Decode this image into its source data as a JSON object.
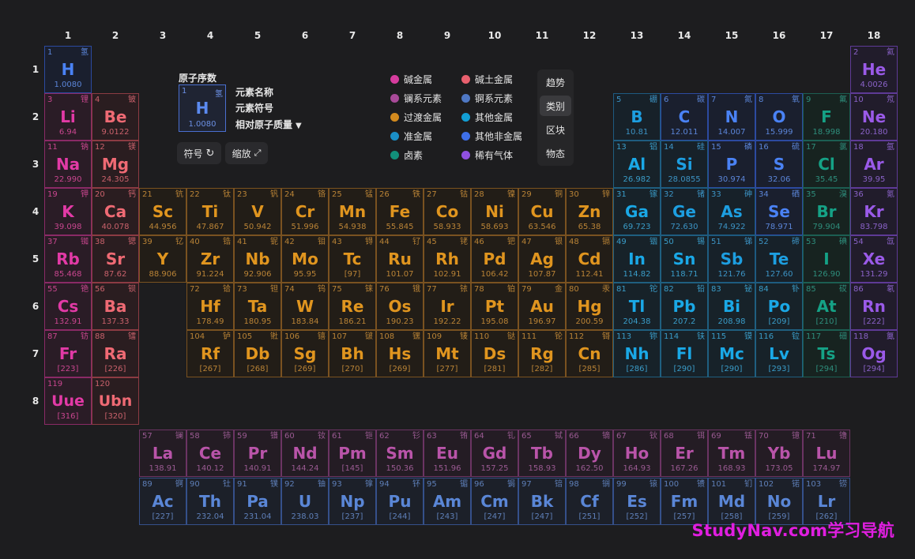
{
  "groups": [
    "1",
    "2",
    "3",
    "4",
    "5",
    "6",
    "7",
    "8",
    "9",
    "10",
    "11",
    "12",
    "13",
    "14",
    "15",
    "16",
    "17",
    "18"
  ],
  "periods": [
    "1",
    "2",
    "3",
    "4",
    "5",
    "6",
    "7",
    "8"
  ],
  "legend_key": {
    "atomic_number_label": "原子序数",
    "name_label": "元素名称",
    "symbol_label": "元素符号",
    "mass_label": "相对原子质量",
    "sample": {
      "num": "1",
      "cn": "氢",
      "sym": "H",
      "mass": "1.0080"
    }
  },
  "controls": {
    "symbol_label": "符号",
    "zoom_label": "缩放"
  },
  "categories": [
    {
      "key": "alkali",
      "label": "碱金属",
      "color": "#d63c9e"
    },
    {
      "key": "alkaline",
      "label": "碱土金属",
      "color": "#e8606e"
    },
    {
      "key": "lanthanide",
      "label": "镧系元素",
      "color": "#a84a98"
    },
    {
      "key": "actinide",
      "label": "锕系元素",
      "color": "#4f78c4"
    },
    {
      "key": "transition",
      "label": "过渡金属",
      "color": "#d38a1e"
    },
    {
      "key": "post",
      "label": "其他金属",
      "color": "#129ed4"
    },
    {
      "key": "metalloid",
      "label": "准金属",
      "color": "#1b8fc6"
    },
    {
      "key": "nonmetal",
      "label": "其他非金属",
      "color": "#3e6fe8"
    },
    {
      "key": "halogen",
      "label": "卤素",
      "color": "#12907a"
    },
    {
      "key": "noble",
      "label": "稀有气体",
      "color": "#9050e0"
    }
  ],
  "views": [
    {
      "label": "趋势",
      "active": false
    },
    {
      "label": "类别",
      "active": true
    },
    {
      "label": "区块",
      "active": false
    },
    {
      "label": "物态",
      "active": false
    }
  ],
  "watermark": "StudyNav.com学习导航",
  "elements": [
    {
      "n": "1",
      "s": "H",
      "c": "氢",
      "m": "1.0080",
      "g": 1,
      "p": 1,
      "k": "nonmetal"
    },
    {
      "n": "2",
      "s": "He",
      "c": "氦",
      "m": "4.0026",
      "g": 18,
      "p": 1,
      "k": "noble"
    },
    {
      "n": "3",
      "s": "Li",
      "c": "锂",
      "m": "6.94",
      "g": 1,
      "p": 2,
      "k": "alkali"
    },
    {
      "n": "4",
      "s": "Be",
      "c": "铍",
      "m": "9.0122",
      "g": 2,
      "p": 2,
      "k": "alkaline"
    },
    {
      "n": "5",
      "s": "B",
      "c": "硼",
      "m": "10.81",
      "g": 13,
      "p": 2,
      "k": "metalloid"
    },
    {
      "n": "6",
      "s": "C",
      "c": "碳",
      "m": "12.011",
      "g": 14,
      "p": 2,
      "k": "nonmetal"
    },
    {
      "n": "7",
      "s": "N",
      "c": "氮",
      "m": "14.007",
      "g": 15,
      "p": 2,
      "k": "nonmetal"
    },
    {
      "n": "8",
      "s": "O",
      "c": "氧",
      "m": "15.999",
      "g": 16,
      "p": 2,
      "k": "nonmetal"
    },
    {
      "n": "9",
      "s": "F",
      "c": "氟",
      "m": "18.998",
      "g": 17,
      "p": 2,
      "k": "halogen"
    },
    {
      "n": "10",
      "s": "Ne",
      "c": "氖",
      "m": "20.180",
      "g": 18,
      "p": 2,
      "k": "noble"
    },
    {
      "n": "11",
      "s": "Na",
      "c": "钠",
      "m": "22.990",
      "g": 1,
      "p": 3,
      "k": "alkali"
    },
    {
      "n": "12",
      "s": "Mg",
      "c": "镁",
      "m": "24.305",
      "g": 2,
      "p": 3,
      "k": "alkaline"
    },
    {
      "n": "13",
      "s": "Al",
      "c": "铝",
      "m": "26.982",
      "g": 13,
      "p": 3,
      "k": "post"
    },
    {
      "n": "14",
      "s": "Si",
      "c": "硅",
      "m": "28.0855",
      "g": 14,
      "p": 3,
      "k": "metalloid"
    },
    {
      "n": "15",
      "s": "P",
      "c": "磷",
      "m": "30.974",
      "g": 15,
      "p": 3,
      "k": "nonmetal"
    },
    {
      "n": "16",
      "s": "S",
      "c": "硫",
      "m": "32.06",
      "g": 16,
      "p": 3,
      "k": "nonmetal"
    },
    {
      "n": "17",
      "s": "Cl",
      "c": "氯",
      "m": "35.45",
      "g": 17,
      "p": 3,
      "k": "halogen"
    },
    {
      "n": "18",
      "s": "Ar",
      "c": "氩",
      "m": "39.95",
      "g": 18,
      "p": 3,
      "k": "noble"
    },
    {
      "n": "19",
      "s": "K",
      "c": "钾",
      "m": "39.098",
      "g": 1,
      "p": 4,
      "k": "alkali"
    },
    {
      "n": "20",
      "s": "Ca",
      "c": "钙",
      "m": "40.078",
      "g": 2,
      "p": 4,
      "k": "alkaline"
    },
    {
      "n": "21",
      "s": "Sc",
      "c": "钪",
      "m": "44.956",
      "g": 3,
      "p": 4,
      "k": "transition"
    },
    {
      "n": "22",
      "s": "Ti",
      "c": "钛",
      "m": "47.867",
      "g": 4,
      "p": 4,
      "k": "transition"
    },
    {
      "n": "23",
      "s": "V",
      "c": "钒",
      "m": "50.942",
      "g": 5,
      "p": 4,
      "k": "transition"
    },
    {
      "n": "24",
      "s": "Cr",
      "c": "铬",
      "m": "51.996",
      "g": 6,
      "p": 4,
      "k": "transition"
    },
    {
      "n": "25",
      "s": "Mn",
      "c": "锰",
      "m": "54.938",
      "g": 7,
      "p": 4,
      "k": "transition"
    },
    {
      "n": "26",
      "s": "Fe",
      "c": "铁",
      "m": "55.845",
      "g": 8,
      "p": 4,
      "k": "transition"
    },
    {
      "n": "27",
      "s": "Co",
      "c": "钴",
      "m": "58.933",
      "g": 9,
      "p": 4,
      "k": "transition"
    },
    {
      "n": "28",
      "s": "Ni",
      "c": "镍",
      "m": "58.693",
      "g": 10,
      "p": 4,
      "k": "transition"
    },
    {
      "n": "29",
      "s": "Cu",
      "c": "铜",
      "m": "63.546",
      "g": 11,
      "p": 4,
      "k": "transition"
    },
    {
      "n": "30",
      "s": "Zn",
      "c": "锌",
      "m": "65.38",
      "g": 12,
      "p": 4,
      "k": "transition"
    },
    {
      "n": "31",
      "s": "Ga",
      "c": "镓",
      "m": "69.723",
      "g": 13,
      "p": 4,
      "k": "post"
    },
    {
      "n": "32",
      "s": "Ge",
      "c": "锗",
      "m": "72.630",
      "g": 14,
      "p": 4,
      "k": "metalloid"
    },
    {
      "n": "33",
      "s": "As",
      "c": "砷",
      "m": "74.922",
      "g": 15,
      "p": 4,
      "k": "metalloid"
    },
    {
      "n": "34",
      "s": "Se",
      "c": "硒",
      "m": "78.971",
      "g": 16,
      "p": 4,
      "k": "nonmetal"
    },
    {
      "n": "35",
      "s": "Br",
      "c": "溴",
      "m": "79.904",
      "g": 17,
      "p": 4,
      "k": "halogen"
    },
    {
      "n": "36",
      "s": "Kr",
      "c": "氪",
      "m": "83.798",
      "g": 18,
      "p": 4,
      "k": "noble"
    },
    {
      "n": "37",
      "s": "Rb",
      "c": "铷",
      "m": "85.468",
      "g": 1,
      "p": 5,
      "k": "alkali"
    },
    {
      "n": "38",
      "s": "Sr",
      "c": "锶",
      "m": "87.62",
      "g": 2,
      "p": 5,
      "k": "alkaline"
    },
    {
      "n": "39",
      "s": "Y",
      "c": "钇",
      "m": "88.906",
      "g": 3,
      "p": 5,
      "k": "transition"
    },
    {
      "n": "40",
      "s": "Zr",
      "c": "锆",
      "m": "91.224",
      "g": 4,
      "p": 5,
      "k": "transition"
    },
    {
      "n": "41",
      "s": "Nb",
      "c": "铌",
      "m": "92.906",
      "g": 5,
      "p": 5,
      "k": "transition"
    },
    {
      "n": "42",
      "s": "Mo",
      "c": "钼",
      "m": "95.95",
      "g": 6,
      "p": 5,
      "k": "transition"
    },
    {
      "n": "43",
      "s": "Tc",
      "c": "锝",
      "m": "[97]",
      "g": 7,
      "p": 5,
      "k": "transition"
    },
    {
      "n": "44",
      "s": "Ru",
      "c": "钌",
      "m": "101.07",
      "g": 8,
      "p": 5,
      "k": "transition"
    },
    {
      "n": "45",
      "s": "Rh",
      "c": "铑",
      "m": "102.91",
      "g": 9,
      "p": 5,
      "k": "transition"
    },
    {
      "n": "46",
      "s": "Pd",
      "c": "钯",
      "m": "106.42",
      "g": 10,
      "p": 5,
      "k": "transition"
    },
    {
      "n": "47",
      "s": "Ag",
      "c": "银",
      "m": "107.87",
      "g": 11,
      "p": 5,
      "k": "transition"
    },
    {
      "n": "48",
      "s": "Cd",
      "c": "镉",
      "m": "112.41",
      "g": 12,
      "p": 5,
      "k": "transition"
    },
    {
      "n": "49",
      "s": "In",
      "c": "铟",
      "m": "114.82",
      "g": 13,
      "p": 5,
      "k": "post"
    },
    {
      "n": "50",
      "s": "Sn",
      "c": "锡",
      "m": "118.71",
      "g": 14,
      "p": 5,
      "k": "post"
    },
    {
      "n": "51",
      "s": "Sb",
      "c": "锑",
      "m": "121.76",
      "g": 15,
      "p": 5,
      "k": "metalloid"
    },
    {
      "n": "52",
      "s": "Te",
      "c": "碲",
      "m": "127.60",
      "g": 16,
      "p": 5,
      "k": "metalloid"
    },
    {
      "n": "53",
      "s": "I",
      "c": "碘",
      "m": "126.90",
      "g": 17,
      "p": 5,
      "k": "halogen"
    },
    {
      "n": "54",
      "s": "Xe",
      "c": "氙",
      "m": "131.29",
      "g": 18,
      "p": 5,
      "k": "noble"
    },
    {
      "n": "55",
      "s": "Cs",
      "c": "铯",
      "m": "132.91",
      "g": 1,
      "p": 6,
      "k": "alkali"
    },
    {
      "n": "56",
      "s": "Ba",
      "c": "钡",
      "m": "137.33",
      "g": 2,
      "p": 6,
      "k": "alkaline"
    },
    {
      "n": "72",
      "s": "Hf",
      "c": "铪",
      "m": "178.49",
      "g": 4,
      "p": 6,
      "k": "transition"
    },
    {
      "n": "73",
      "s": "Ta",
      "c": "钽",
      "m": "180.95",
      "g": 5,
      "p": 6,
      "k": "transition"
    },
    {
      "n": "74",
      "s": "W",
      "c": "钨",
      "m": "183.84",
      "g": 6,
      "p": 6,
      "k": "transition"
    },
    {
      "n": "75",
      "s": "Re",
      "c": "铼",
      "m": "186.21",
      "g": 7,
      "p": 6,
      "k": "transition"
    },
    {
      "n": "76",
      "s": "Os",
      "c": "锇",
      "m": "190.23",
      "g": 8,
      "p": 6,
      "k": "transition"
    },
    {
      "n": "77",
      "s": "Ir",
      "c": "铱",
      "m": "192.22",
      "g": 9,
      "p": 6,
      "k": "transition"
    },
    {
      "n": "78",
      "s": "Pt",
      "c": "铂",
      "m": "195.08",
      "g": 10,
      "p": 6,
      "k": "transition"
    },
    {
      "n": "79",
      "s": "Au",
      "c": "金",
      "m": "196.97",
      "g": 11,
      "p": 6,
      "k": "transition"
    },
    {
      "n": "80",
      "s": "Hg",
      "c": "汞",
      "m": "200.59",
      "g": 12,
      "p": 6,
      "k": "transition"
    },
    {
      "n": "81",
      "s": "Tl",
      "c": "铊",
      "m": "204.38",
      "g": 13,
      "p": 6,
      "k": "post"
    },
    {
      "n": "82",
      "s": "Pb",
      "c": "铅",
      "m": "207.2",
      "g": 14,
      "p": 6,
      "k": "post"
    },
    {
      "n": "83",
      "s": "Bi",
      "c": "铋",
      "m": "208.98",
      "g": 15,
      "p": 6,
      "k": "post"
    },
    {
      "n": "84",
      "s": "Po",
      "c": "钋",
      "m": "[209]",
      "g": 16,
      "p": 6,
      "k": "post"
    },
    {
      "n": "85",
      "s": "At",
      "c": "砹",
      "m": "[210]",
      "g": 17,
      "p": 6,
      "k": "halogen"
    },
    {
      "n": "86",
      "s": "Rn",
      "c": "氡",
      "m": "[222]",
      "g": 18,
      "p": 6,
      "k": "noble"
    },
    {
      "n": "87",
      "s": "Fr",
      "c": "钫",
      "m": "[223]",
      "g": 1,
      "p": 7,
      "k": "alkali"
    },
    {
      "n": "88",
      "s": "Ra",
      "c": "镭",
      "m": "[226]",
      "g": 2,
      "p": 7,
      "k": "alkaline"
    },
    {
      "n": "104",
      "s": "Rf",
      "c": "𬬻",
      "m": "[267]",
      "g": 4,
      "p": 7,
      "k": "transition"
    },
    {
      "n": "105",
      "s": "Db",
      "c": "𬭊",
      "m": "[268]",
      "g": 5,
      "p": 7,
      "k": "transition"
    },
    {
      "n": "106",
      "s": "Sg",
      "c": "𬭳",
      "m": "[269]",
      "g": 6,
      "p": 7,
      "k": "transition"
    },
    {
      "n": "107",
      "s": "Bh",
      "c": "𬭛",
      "m": "[270]",
      "g": 7,
      "p": 7,
      "k": "transition"
    },
    {
      "n": "108",
      "s": "Hs",
      "c": "𬭶",
      "m": "[269]",
      "g": 8,
      "p": 7,
      "k": "transition"
    },
    {
      "n": "109",
      "s": "Mt",
      "c": "鿏",
      "m": "[277]",
      "g": 9,
      "p": 7,
      "k": "transition"
    },
    {
      "n": "110",
      "s": "Ds",
      "c": "𫟼",
      "m": "[281]",
      "g": 10,
      "p": 7,
      "k": "transition"
    },
    {
      "n": "111",
      "s": "Rg",
      "c": "𬬭",
      "m": "[282]",
      "g": 11,
      "p": 7,
      "k": "transition"
    },
    {
      "n": "112",
      "s": "Cn",
      "c": "鿔",
      "m": "[285]",
      "g": 12,
      "p": 7,
      "k": "transition"
    },
    {
      "n": "113",
      "s": "Nh",
      "c": "鿭",
      "m": "[286]",
      "g": 13,
      "p": 7,
      "k": "post"
    },
    {
      "n": "114",
      "s": "Fl",
      "c": "𫓧",
      "m": "[290]",
      "g": 14,
      "p": 7,
      "k": "post"
    },
    {
      "n": "115",
      "s": "Mc",
      "c": "镆",
      "m": "[290]",
      "g": 15,
      "p": 7,
      "k": "post"
    },
    {
      "n": "116",
      "s": "Lv",
      "c": "𫟷",
      "m": "[293]",
      "g": 16,
      "p": 7,
      "k": "post"
    },
    {
      "n": "117",
      "s": "Ts",
      "c": "鿬",
      "m": "[294]",
      "g": 17,
      "p": 7,
      "k": "halogen"
    },
    {
      "n": "118",
      "s": "Og",
      "c": "鿫",
      "m": "[294]",
      "g": 18,
      "p": 7,
      "k": "noble"
    },
    {
      "n": "119",
      "s": "Uue",
      "c": "",
      "m": "[316]",
      "g": 1,
      "p": 8,
      "k": "alkali"
    },
    {
      "n": "120",
      "s": "Ubn",
      "c": "",
      "m": "[320]",
      "g": 2,
      "p": 8,
      "k": "alkaline"
    },
    {
      "n": "57",
      "s": "La",
      "c": "镧",
      "m": "138.91",
      "g": 3,
      "p": 9,
      "k": "lanthanide"
    },
    {
      "n": "58",
      "s": "Ce",
      "c": "铈",
      "m": "140.12",
      "g": 4,
      "p": 9,
      "k": "lanthanide"
    },
    {
      "n": "59",
      "s": "Pr",
      "c": "镨",
      "m": "140.91",
      "g": 5,
      "p": 9,
      "k": "lanthanide"
    },
    {
      "n": "60",
      "s": "Nd",
      "c": "钕",
      "m": "144.24",
      "g": 6,
      "p": 9,
      "k": "lanthanide"
    },
    {
      "n": "61",
      "s": "Pm",
      "c": "钷",
      "m": "[145]",
      "g": 7,
      "p": 9,
      "k": "lanthanide"
    },
    {
      "n": "62",
      "s": "Sm",
      "c": "钐",
      "m": "150.36",
      "g": 8,
      "p": 9,
      "k": "lanthanide"
    },
    {
      "n": "63",
      "s": "Eu",
      "c": "铕",
      "m": "151.96",
      "g": 9,
      "p": 9,
      "k": "lanthanide"
    },
    {
      "n": "64",
      "s": "Gd",
      "c": "钆",
      "m": "157.25",
      "g": 10,
      "p": 9,
      "k": "lanthanide"
    },
    {
      "n": "65",
      "s": "Tb",
      "c": "铽",
      "m": "158.93",
      "g": 11,
      "p": 9,
      "k": "lanthanide"
    },
    {
      "n": "66",
      "s": "Dy",
      "c": "镝",
      "m": "162.50",
      "g": 12,
      "p": 9,
      "k": "lanthanide"
    },
    {
      "n": "67",
      "s": "Ho",
      "c": "钬",
      "m": "164.93",
      "g": 13,
      "p": 9,
      "k": "lanthanide"
    },
    {
      "n": "68",
      "s": "Er",
      "c": "铒",
      "m": "167.26",
      "g": 14,
      "p": 9,
      "k": "lanthanide"
    },
    {
      "n": "69",
      "s": "Tm",
      "c": "铥",
      "m": "168.93",
      "g": 15,
      "p": 9,
      "k": "lanthanide"
    },
    {
      "n": "70",
      "s": "Yb",
      "c": "镱",
      "m": "173.05",
      "g": 16,
      "p": 9,
      "k": "lanthanide"
    },
    {
      "n": "71",
      "s": "Lu",
      "c": "镥",
      "m": "174.97",
      "g": 17,
      "p": 9,
      "k": "lanthanide"
    },
    {
      "n": "89",
      "s": "Ac",
      "c": "锕",
      "m": "[227]",
      "g": 3,
      "p": 10,
      "k": "actinide"
    },
    {
      "n": "90",
      "s": "Th",
      "c": "钍",
      "m": "232.04",
      "g": 4,
      "p": 10,
      "k": "actinide"
    },
    {
      "n": "91",
      "s": "Pa",
      "c": "镤",
      "m": "231.04",
      "g": 5,
      "p": 10,
      "k": "actinide"
    },
    {
      "n": "92",
      "s": "U",
      "c": "铀",
      "m": "238.03",
      "g": 6,
      "p": 10,
      "k": "actinide"
    },
    {
      "n": "93",
      "s": "Np",
      "c": "镎",
      "m": "[237]",
      "g": 7,
      "p": 10,
      "k": "actinide"
    },
    {
      "n": "94",
      "s": "Pu",
      "c": "钚",
      "m": "[244]",
      "g": 8,
      "p": 10,
      "k": "actinide"
    },
    {
      "n": "95",
      "s": "Am",
      "c": "镅",
      "m": "[243]",
      "g": 9,
      "p": 10,
      "k": "actinide"
    },
    {
      "n": "96",
      "s": "Cm",
      "c": "锔",
      "m": "[247]",
      "g": 10,
      "p": 10,
      "k": "actinide"
    },
    {
      "n": "97",
      "s": "Bk",
      "c": "锫",
      "m": "[247]",
      "g": 11,
      "p": 10,
      "k": "actinide"
    },
    {
      "n": "98",
      "s": "Cf",
      "c": "锎",
      "m": "[251]",
      "g": 12,
      "p": 10,
      "k": "actinide"
    },
    {
      "n": "99",
      "s": "Es",
      "c": "锿",
      "m": "[252]",
      "g": 13,
      "p": 10,
      "k": "actinide"
    },
    {
      "n": "100",
      "s": "Fm",
      "c": "镄",
      "m": "[257]",
      "g": 14,
      "p": 10,
      "k": "actinide"
    },
    {
      "n": "101",
      "s": "Md",
      "c": "钔",
      "m": "[258]",
      "g": 15,
      "p": 10,
      "k": "actinide"
    },
    {
      "n": "102",
      "s": "No",
      "c": "锘",
      "m": "[259]",
      "g": 16,
      "p": 10,
      "k": "actinide"
    },
    {
      "n": "103",
      "s": "Lr",
      "c": "铹",
      "m": "[262]",
      "g": 17,
      "p": 10,
      "k": "actinide"
    }
  ]
}
